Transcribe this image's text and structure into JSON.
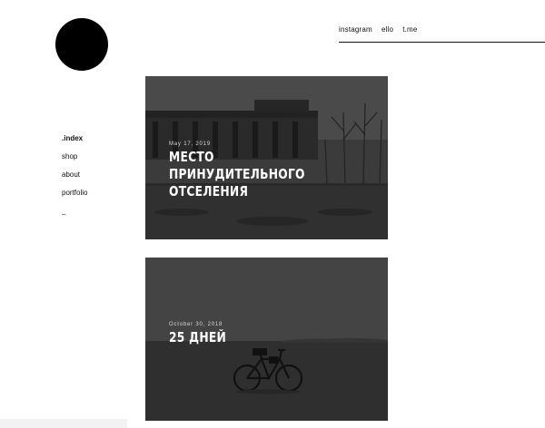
{
  "social_nav": {
    "items": [
      "instagram",
      "ello",
      "t.me"
    ]
  },
  "side_nav": {
    "items": [
      ".index",
      "shop",
      "about",
      "portfolio"
    ],
    "active_index": 0,
    "dash": "–"
  },
  "posts": [
    {
      "date": "May 17, 2019",
      "title": "МЕСТО ПРИНУДИТЕЛЬНОГО ОТСЕЛЕНИЯ"
    },
    {
      "date": "October 30, 2018",
      "title": "25 ДНЕЙ"
    }
  ],
  "colors": {
    "background": "#ffffff",
    "logo": "#000000",
    "text": "#111111",
    "card_overlay": "#3a3a3a"
  },
  "icons": {
    "logo": "black-circle-logo"
  }
}
